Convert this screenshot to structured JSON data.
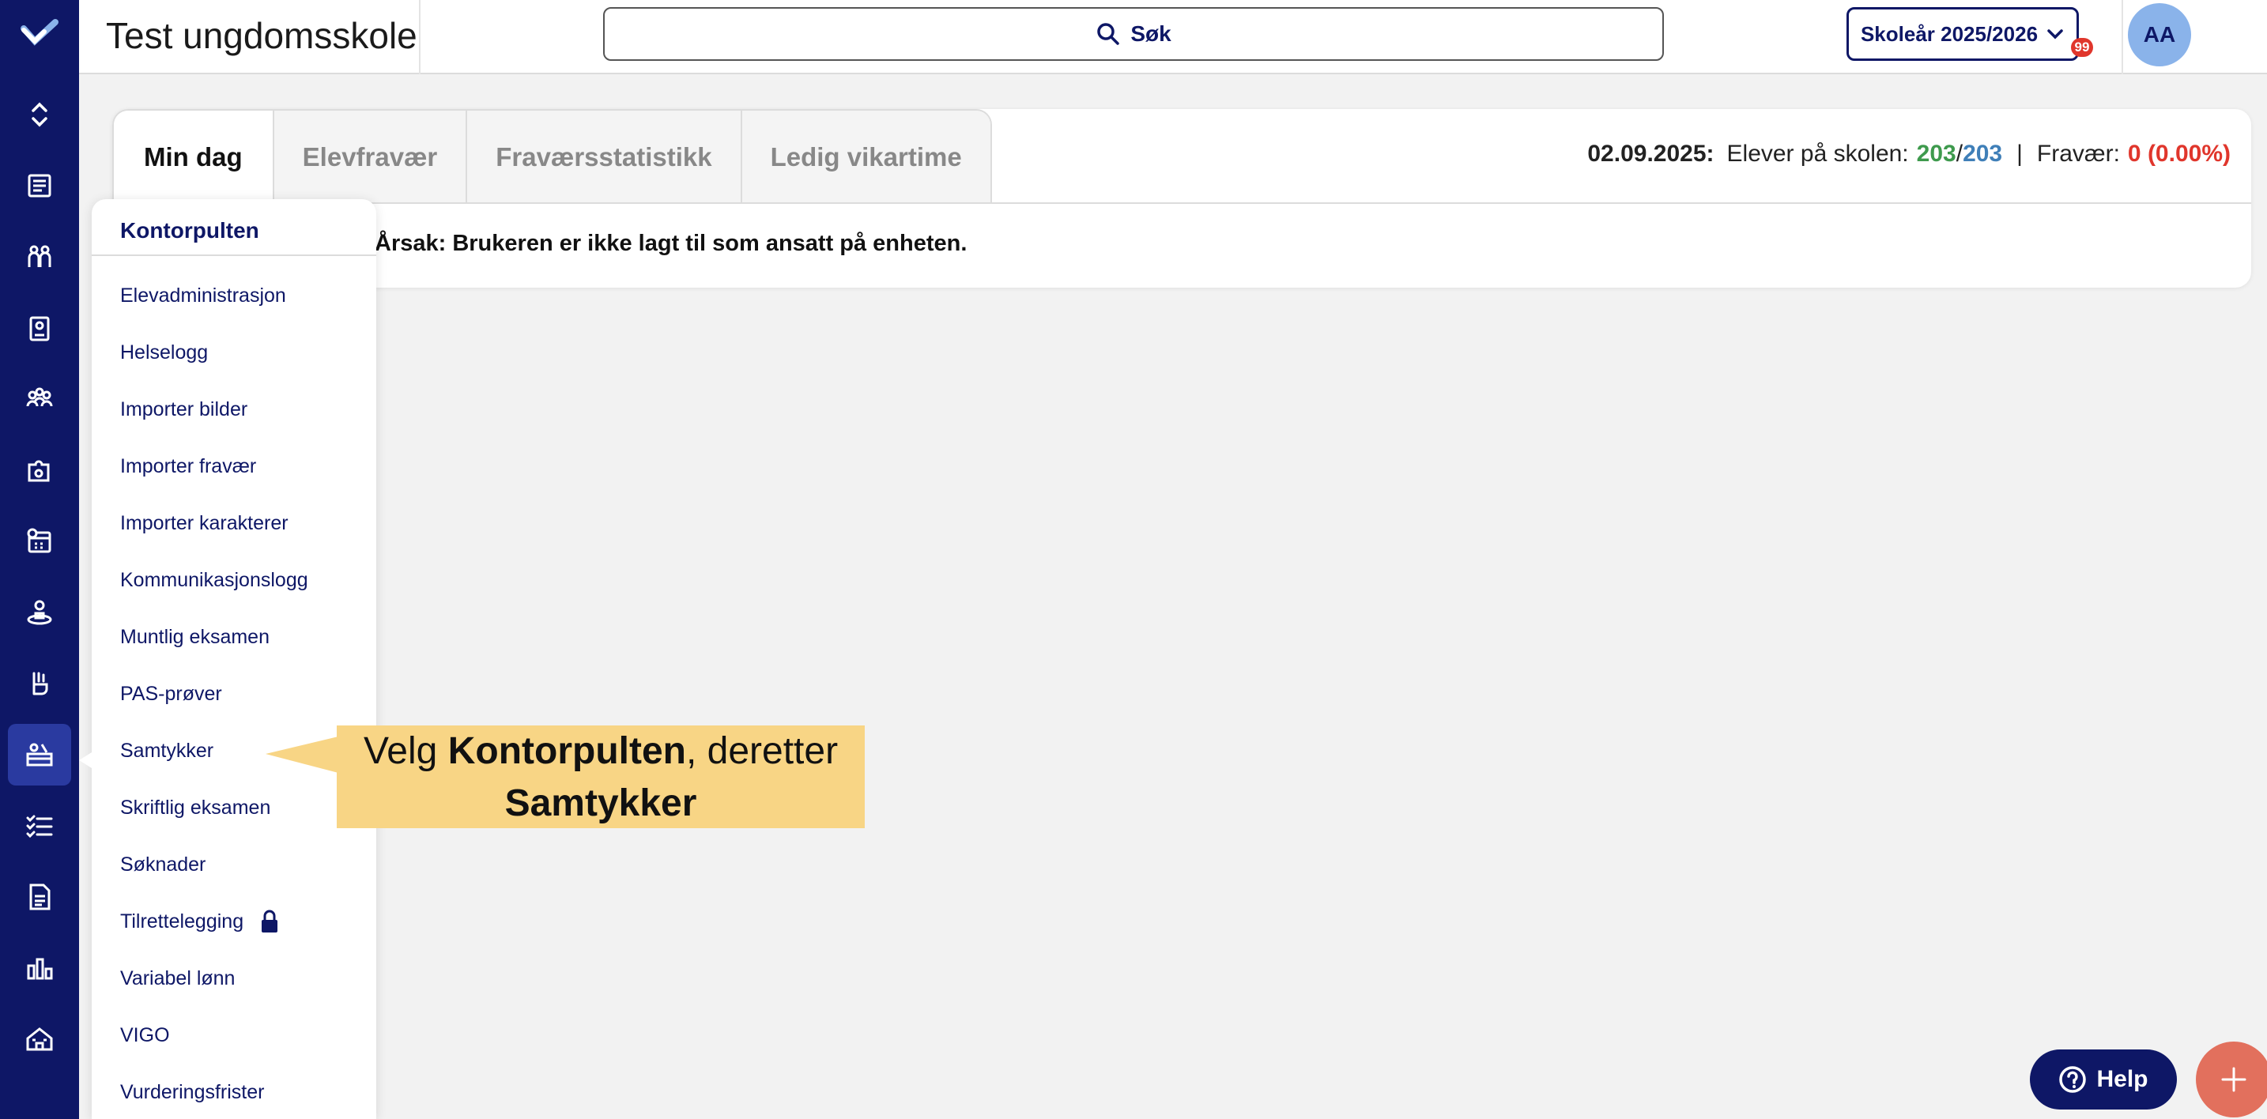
{
  "header": {
    "school_name": "Test ungdomsskole",
    "search_placeholder": "Søk",
    "school_year": "Skoleår 2025/2026",
    "notification_count": "99",
    "avatar_initials": "AA"
  },
  "tabs": [
    {
      "label": "Min dag",
      "active": true
    },
    {
      "label": "Elevfravær",
      "active": false
    },
    {
      "label": "Fraværsstatistikk",
      "active": false
    },
    {
      "label": "Ledig vikartime",
      "active": false
    }
  ],
  "stats": {
    "date": "02.09.2025:",
    "students_label": "Elever på skolen:",
    "students_present": "203",
    "students_separator": "/",
    "students_total": "203",
    "pipe": "|",
    "absence_label": "Fravær:",
    "absence_value": "0 (0.00%)"
  },
  "message": "Årsak: Brukeren er ikke lagt til som ansatt på enheten.",
  "menu": {
    "title": "Kontorpulten",
    "items": [
      {
        "label": "Elevadministrasjon"
      },
      {
        "label": "Helselogg"
      },
      {
        "label": "Importer bilder"
      },
      {
        "label": "Importer fravær"
      },
      {
        "label": "Importer karakterer"
      },
      {
        "label": "Kommunikasjonslogg"
      },
      {
        "label": "Muntlig eksamen"
      },
      {
        "label": "PAS-prøver"
      },
      {
        "label": "Samtykker"
      },
      {
        "label": "Skriftlig eksamen"
      },
      {
        "label": "Søknader"
      },
      {
        "label": "Tilrettelegging",
        "icon": "lock-icon"
      },
      {
        "label": "Variabel lønn"
      },
      {
        "label": "VIGO"
      },
      {
        "label": "Vurderingsfrister"
      }
    ]
  },
  "callout": {
    "line1_prefix": "Velg ",
    "line1_bold": "Kontorpulten",
    "line1_suffix": ", deretter",
    "line2_bold": "Samtykker"
  },
  "help_label": "Help",
  "colors": {
    "navy": "#0e1766",
    "green": "#3e9a4d",
    "blue": "#3f7fb8",
    "red": "#e0362c",
    "callout": "#f8d585"
  },
  "rail_icons": [
    "logo-icon",
    "expand-collapse-icon",
    "news-icon",
    "students-icon",
    "badge-icon",
    "groups-icon",
    "puzzle-icon",
    "calendar-icon",
    "person-rings-icon",
    "hand-icon",
    "office-desk-icon",
    "checklist-icon",
    "document-icon",
    "bar-chart-icon",
    "school-icon"
  ]
}
